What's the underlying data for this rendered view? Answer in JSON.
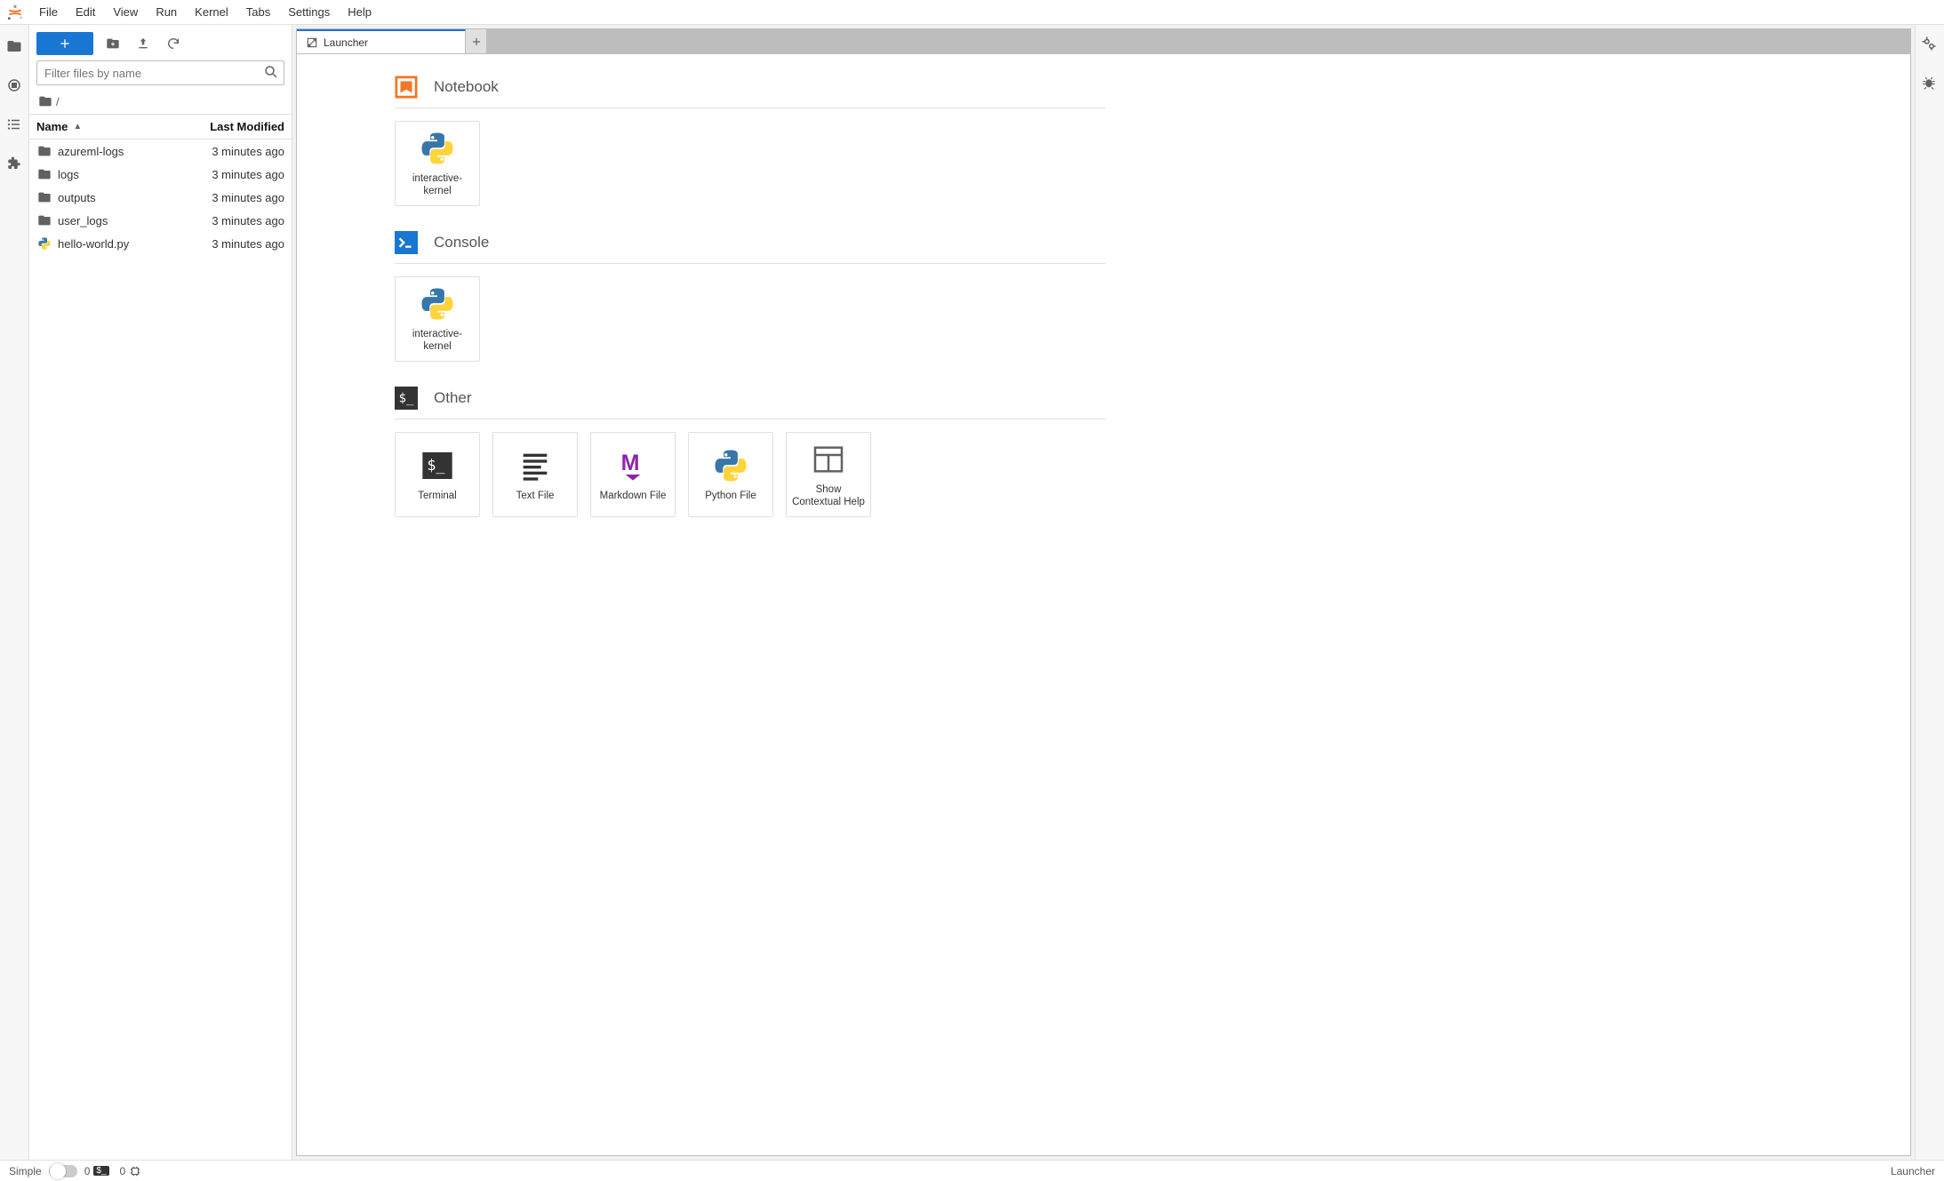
{
  "menubar": {
    "items": [
      "File",
      "Edit",
      "View",
      "Run",
      "Kernel",
      "Tabs",
      "Settings",
      "Help"
    ]
  },
  "filebrowser": {
    "filter_placeholder": "Filter files by name",
    "breadcrumb_root": "/",
    "columns": {
      "name": "Name",
      "modified": "Last Modified"
    },
    "rows": [
      {
        "name": "azureml-logs",
        "modified": "3 minutes ago",
        "type": "folder"
      },
      {
        "name": "logs",
        "modified": "3 minutes ago",
        "type": "folder"
      },
      {
        "name": "outputs",
        "modified": "3 minutes ago",
        "type": "folder"
      },
      {
        "name": "user_logs",
        "modified": "3 minutes ago",
        "type": "folder"
      },
      {
        "name": "hello-world.py",
        "modified": "3 minutes ago",
        "type": "python"
      }
    ]
  },
  "tab": {
    "label": "Launcher"
  },
  "launcher": {
    "sections": [
      {
        "title": "Notebook",
        "icon": "notebook",
        "cards": [
          {
            "label": "interactive-kernel",
            "icon": "python"
          }
        ]
      },
      {
        "title": "Console",
        "icon": "console",
        "cards": [
          {
            "label": "interactive-kernel",
            "icon": "python"
          }
        ]
      },
      {
        "title": "Other",
        "icon": "terminal-dark",
        "cards": [
          {
            "label": "Terminal",
            "icon": "terminal-dark"
          },
          {
            "label": "Text File",
            "icon": "textfile"
          },
          {
            "label": "Markdown File",
            "icon": "markdown"
          },
          {
            "label": "Python File",
            "icon": "python"
          },
          {
            "label": "Show Contextual Help",
            "icon": "contexthelp"
          }
        ]
      }
    ]
  },
  "statusbar": {
    "simple_label": "Simple",
    "terminals_count": "0",
    "kernels_count": "0",
    "mode": "Launcher"
  }
}
